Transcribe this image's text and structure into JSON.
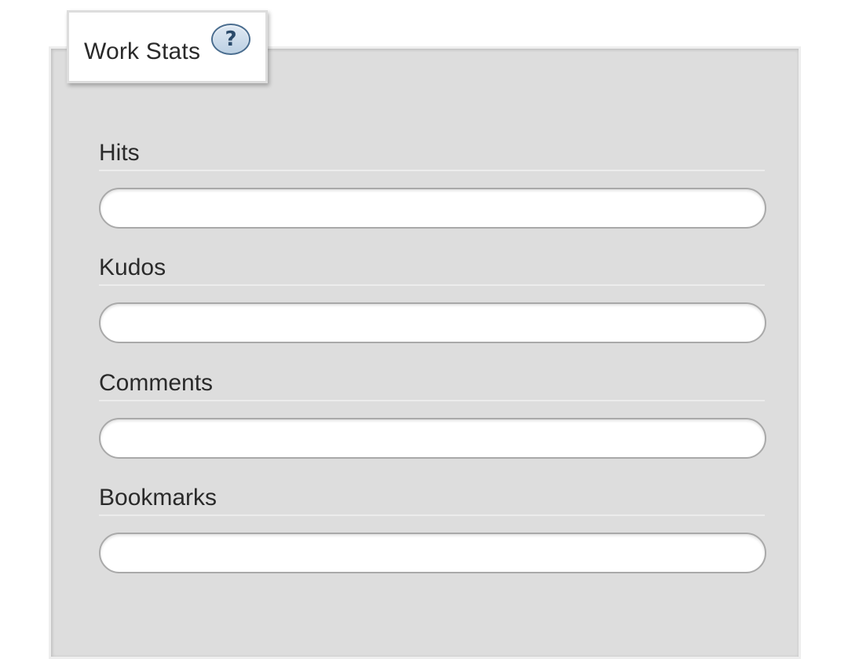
{
  "work_stats": {
    "title": "Work Stats",
    "help_label": "?",
    "fields": [
      {
        "label": "Hits",
        "value": ""
      },
      {
        "label": "Kudos",
        "value": ""
      },
      {
        "label": "Comments",
        "value": ""
      },
      {
        "label": "Bookmarks",
        "value": ""
      }
    ]
  }
}
